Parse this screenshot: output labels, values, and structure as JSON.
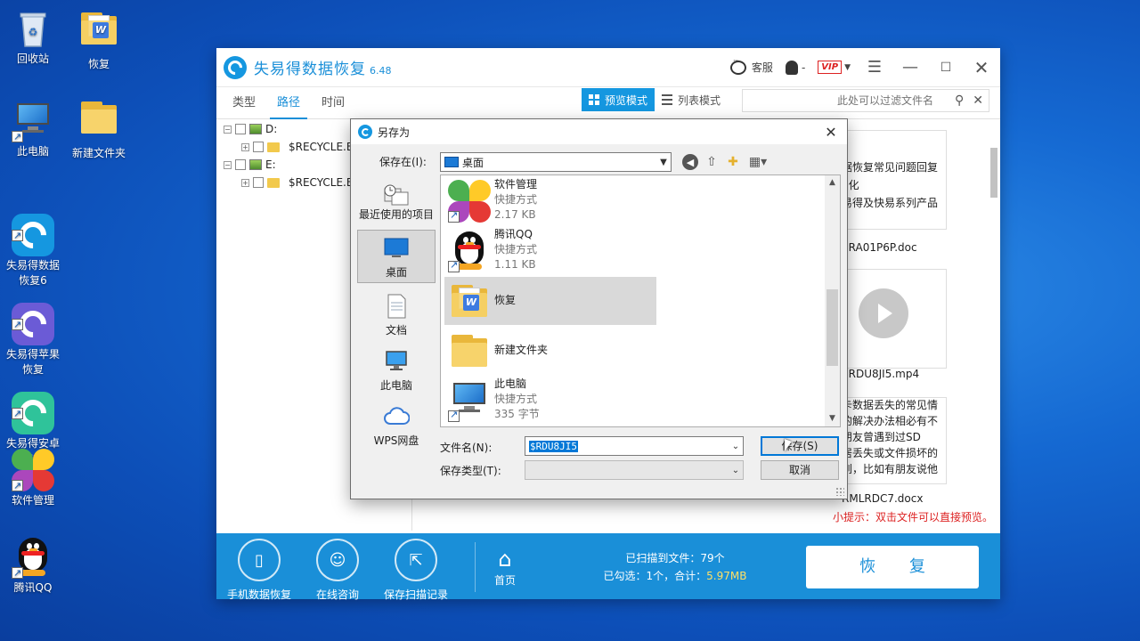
{
  "desktop": {
    "icons": [
      {
        "label": "回收站"
      },
      {
        "label": "恢复"
      },
      {
        "label": "此电脑"
      },
      {
        "label": "新建文件夹"
      },
      {
        "label": "失易得数据\n恢复6"
      },
      {
        "label": "失易得苹果\n恢复"
      },
      {
        "label": "失易得安卓\n恢复"
      },
      {
        "label": "软件管理"
      },
      {
        "label": "腾讯QQ"
      }
    ]
  },
  "app": {
    "title": "失易得数据恢复",
    "version": "6.48",
    "service_label": "客服",
    "user_label": "-",
    "vip_label": "VIP",
    "tabs": [
      "类型",
      "路径",
      "时间"
    ],
    "active_tab": "路径",
    "view_modes": {
      "preview": "预览模式",
      "list": "列表模式"
    },
    "filter_placeholder": "此处可以过滤文件名",
    "tree": [
      {
        "label": "D:"
      },
      {
        "label": "$RECYCLE.BI"
      },
      {
        "label": "E:"
      },
      {
        "label": "$RECYCLE.BI"
      }
    ],
    "cards": {
      "card1_lines": [
        "据恢复常见问题回复",
        "E化",
        "易得及快易系列产品"
      ],
      "card2_name": "$RA01P6P.doc",
      "card3_name": "$RDU8JI5.mp4",
      "card4_lines": [
        "卡数据丢失的常见情",
        "的解决办法相必有不",
        "朋友曾遇到过SD",
        "居丢失或文件损坏的",
        "到，比如有朋友说他"
      ],
      "card5_name": "RMLRDC7.docx"
    },
    "hint": "小提示：双击文件可以直接预览。",
    "bottom": {
      "buttons": [
        "手机数据恢复",
        "在线咨询",
        "保存扫描记录"
      ],
      "home": "首页",
      "scanned_label": "已扫描到文件：",
      "scanned_count": "79个",
      "selected_label": "已勾选：",
      "selected_count": "1个",
      "total_label": "，合计：",
      "total_size": "5.97MB",
      "recover_btn": "恢 复"
    },
    "accent_color": "#1a8fd8"
  },
  "dialog": {
    "title": "另存为",
    "save_in_label": "保存在(I):",
    "save_in_value": "桌面",
    "places": [
      "最近使用的项目",
      "桌面",
      "文档",
      "此电脑",
      "WPS网盘"
    ],
    "active_place": "桌面",
    "files": [
      {
        "name": "软件管理",
        "type": "快捷方式",
        "size": "2.17 KB"
      },
      {
        "name": "腾讯QQ",
        "type": "快捷方式",
        "size": "1.11 KB"
      },
      {
        "name": "恢复",
        "type": "",
        "size": ""
      },
      {
        "name": "新建文件夹",
        "type": "",
        "size": ""
      },
      {
        "name": "此电脑",
        "type": "快捷方式",
        "size": "335 字节"
      }
    ],
    "selected_file": "恢复",
    "filename_label": "文件名(N):",
    "filename_value": "$RDU8JI5",
    "filetype_label": "保存类型(T):",
    "filetype_value": "",
    "save_btn": "保存(S)",
    "cancel_btn": "取消"
  }
}
